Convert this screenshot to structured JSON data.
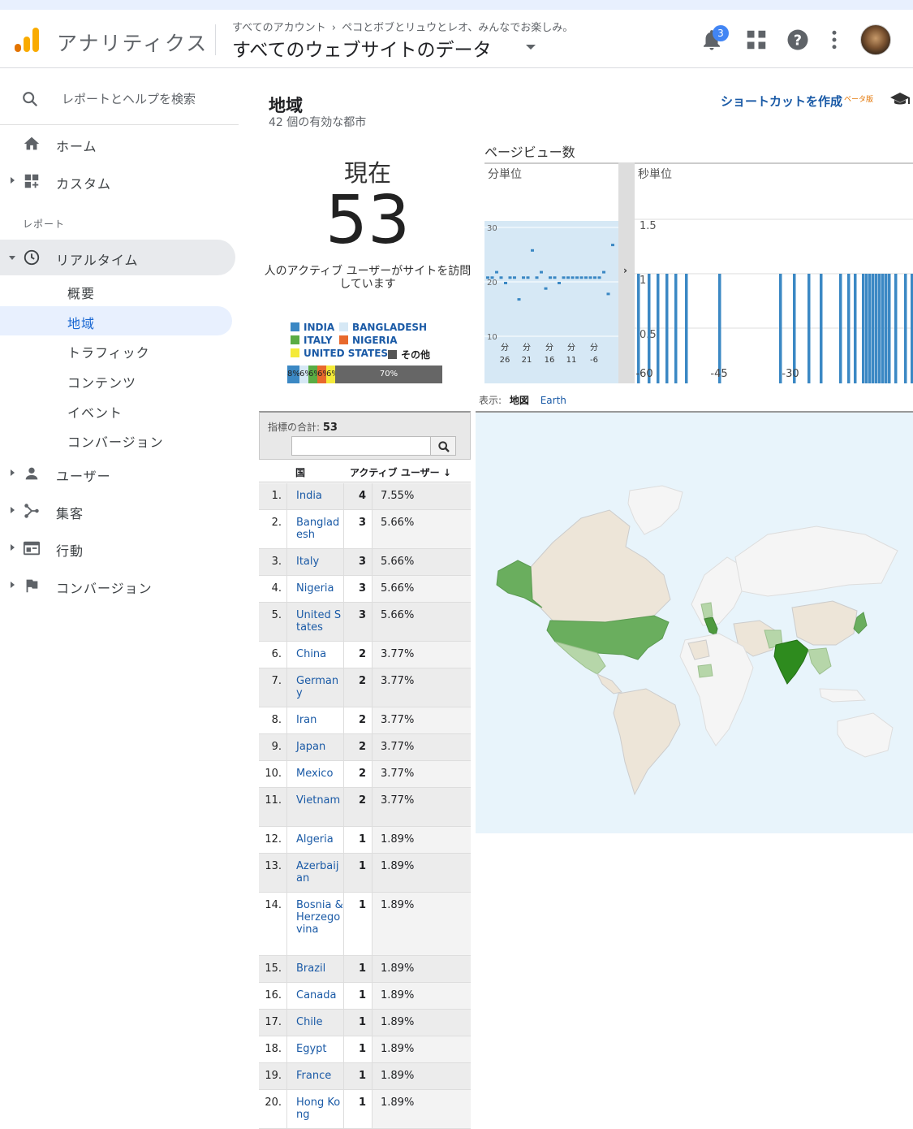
{
  "header": {
    "app_name": "アナリティクス",
    "breadcrumb_account": "すべてのアカウント",
    "breadcrumb_property": "ペコとボブとリュウとレオ、みんなでお楽しみ。",
    "view_name": "すべてのウェブサイトのデータ",
    "notification_count": "3"
  },
  "sidebar": {
    "search_label": "レポートとヘルプを検索",
    "home": "ホーム",
    "custom": "カスタム",
    "section_reports": "レポート",
    "realtime": "リアルタイム",
    "realtime_items": [
      "概要",
      "地域",
      "トラフィック",
      "コンテンツ",
      "イベント",
      "コンバージョン"
    ],
    "users": "ユーザー",
    "acquisition": "集客",
    "behavior": "行動",
    "conversions": "コンバージョン"
  },
  "page": {
    "title": "地域",
    "subtitle": "42 個の有効な都市",
    "shortcut": "ショートカットを作成",
    "beta": "ベータ版"
  },
  "now": {
    "label": "現在",
    "count": "53",
    "description": "人のアクティブ ユーザーがサイトを訪問しています"
  },
  "legend": {
    "items": [
      {
        "label": "INDIA",
        "color": "#3b88c4"
      },
      {
        "label": "BANGLADESH",
        "color": "#d6e8f5"
      },
      {
        "label": "ITALY",
        "color": "#5aac44"
      },
      {
        "label": "NIGERIA",
        "color": "#e8692c"
      },
      {
        "label": "UNITED STATES",
        "color": "#f4ea3a"
      },
      {
        "label": "その他",
        "color": "#555555"
      }
    ],
    "bar_segments": [
      {
        "label": "8%",
        "color": "#3b88c4",
        "value": 8
      },
      {
        "label": "6%",
        "color": "#d6e8f5",
        "value": 6
      },
      {
        "label": "6%",
        "color": "#5aac44",
        "value": 6
      },
      {
        "label": "6%",
        "color": "#e8692c",
        "value": 6
      },
      {
        "label": "6%",
        "color": "#f4ea3a",
        "value": 6
      },
      {
        "label": "70%",
        "color": "#666666",
        "value": 70
      }
    ]
  },
  "pageviews": {
    "title": "ページビュー数",
    "minute_label": "分単位",
    "second_label": "秒単位",
    "minute_yticks": [
      "30",
      "20",
      "10"
    ],
    "minute_xticks": [
      "分\n26",
      "分\n21",
      "分\n16",
      "分\n11",
      "分\n-6"
    ],
    "second_yticks": [
      "1.5",
      "1",
      "0.5"
    ],
    "second_xticks": [
      "-60",
      "-45",
      "-30"
    ]
  },
  "map": {
    "view_label": "表示:",
    "map_option": "地図",
    "earth_option": "Earth"
  },
  "table": {
    "total_label": "指標の合計:",
    "total_value": "53",
    "col_country": "国",
    "col_users": "アクティブ ユーザー",
    "rows": [
      {
        "idx": "1.",
        "name": "India",
        "val": "4",
        "pct": "7.55%",
        "h": 33
      },
      {
        "idx": "2.",
        "name": "Bangladesh",
        "val": "3",
        "pct": "5.66%",
        "h": 48
      },
      {
        "idx": "3.",
        "name": "Italy",
        "val": "3",
        "pct": "5.66%",
        "h": 33
      },
      {
        "idx": "4.",
        "name": "Nigeria",
        "val": "3",
        "pct": "5.66%",
        "h": 33
      },
      {
        "idx": "5.",
        "name": "United States",
        "val": "3",
        "pct": "5.66%",
        "h": 48
      },
      {
        "idx": "6.",
        "name": "China",
        "val": "2",
        "pct": "3.77%",
        "h": 33
      },
      {
        "idx": "7.",
        "name": "Germany",
        "val": "2",
        "pct": "3.77%",
        "h": 48
      },
      {
        "idx": "8.",
        "name": "Iran",
        "val": "2",
        "pct": "3.77%",
        "h": 33
      },
      {
        "idx": "9.",
        "name": "Japan",
        "val": "2",
        "pct": "3.77%",
        "h": 33
      },
      {
        "idx": "10.",
        "name": "Mexico",
        "val": "2",
        "pct": "3.77%",
        "h": 33
      },
      {
        "idx": "11.",
        "name": "Vietnam",
        "val": "2",
        "pct": "3.77%",
        "h": 48
      },
      {
        "idx": "12.",
        "name": "Algeria",
        "val": "1",
        "pct": "1.89%",
        "h": 33
      },
      {
        "idx": "13.",
        "name": "Azerbaijan",
        "val": "1",
        "pct": "1.89%",
        "h": 48
      },
      {
        "idx": "14.",
        "name": "Bosnia & Herzegovina",
        "val": "1",
        "pct": "1.89%",
        "h": 78
      },
      {
        "idx": "15.",
        "name": "Brazil",
        "val": "1",
        "pct": "1.89%",
        "h": 33
      },
      {
        "idx": "16.",
        "name": "Canada",
        "val": "1",
        "pct": "1.89%",
        "h": 33
      },
      {
        "idx": "17.",
        "name": "Chile",
        "val": "1",
        "pct": "1.89%",
        "h": 33
      },
      {
        "idx": "18.",
        "name": "Egypt",
        "val": "1",
        "pct": "1.89%",
        "h": 33
      },
      {
        "idx": "19.",
        "name": "France",
        "val": "1",
        "pct": "1.89%",
        "h": 33
      },
      {
        "idx": "20.",
        "name": "Hong Kong",
        "val": "1",
        "pct": "1.89%",
        "h": 48
      }
    ]
  }
}
